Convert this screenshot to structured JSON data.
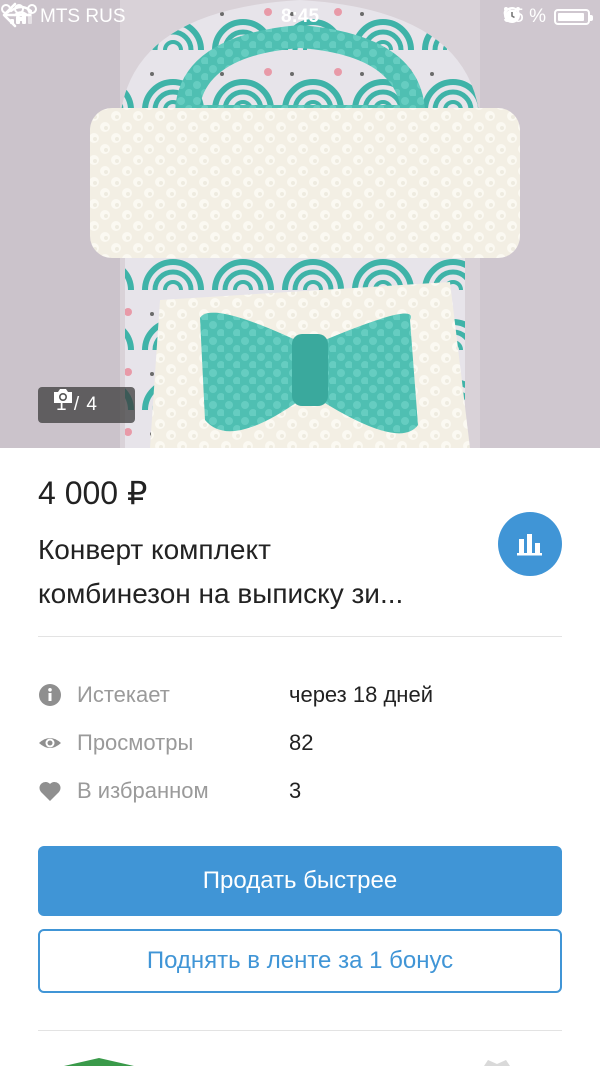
{
  "status_bar": {
    "carrier": "MTS RUS",
    "time": "8:45",
    "battery": "95 %",
    "battery_level": 0.95
  },
  "gallery": {
    "counter": "1 / 4",
    "current": 1,
    "total": 4
  },
  "listing": {
    "price": "4 000 ₽",
    "title_line1": "Конверт комплект",
    "title_line2": "комбинезон на выписку зи..."
  },
  "info": {
    "expires_label": "Истекает",
    "expires_value": "через 18 дней",
    "views_label": "Просмотры",
    "views_value": "82",
    "favorites_label": "В избранном",
    "favorites_value": "3"
  },
  "actions": {
    "sell_faster": "Продать быстрее",
    "bump": "Поднять в ленте за 1 бонус"
  },
  "colors": {
    "accent": "#4095d6",
    "muted_text": "#9a9a9a",
    "divider": "#e3e3e3"
  },
  "icons": {
    "back": "arrow-left-icon",
    "more": "ellipsis-icon",
    "camera": "camera-icon",
    "stats": "bar-chart-icon",
    "info": "info-icon",
    "views": "eye-icon",
    "favorites": "heart-icon"
  }
}
